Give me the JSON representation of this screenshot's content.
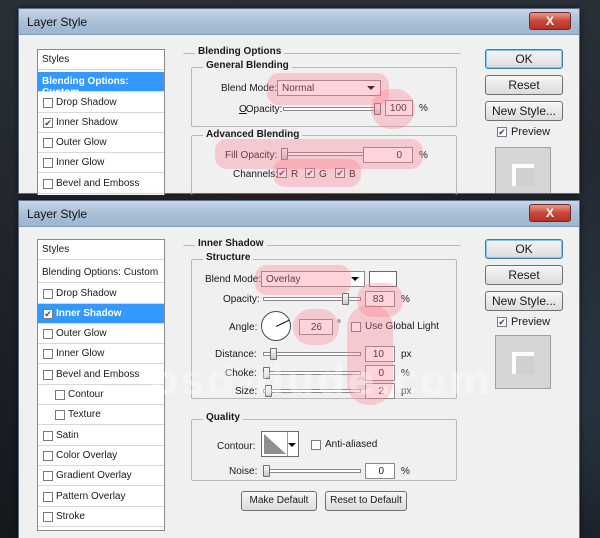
{
  "top_dialog": {
    "title": "Layer Style",
    "close": "X",
    "styles_list": {
      "header": "Styles",
      "selected": "Blending Options: Custom",
      "items": [
        {
          "label": "Drop Shadow",
          "checked": false
        },
        {
          "label": "Inner Shadow",
          "checked": true
        },
        {
          "label": "Outer Glow",
          "checked": false
        },
        {
          "label": "Inner Glow",
          "checked": false
        },
        {
          "label": "Bevel and Emboss",
          "checked": false
        }
      ]
    },
    "blending_options": {
      "title": "Blending Options",
      "general": {
        "title": "General Blending",
        "blend_mode_label": "Blend Mode:",
        "blend_mode_value": "Normal",
        "opacity_label": "Opacity:",
        "opacity_value": "100",
        "opacity_unit": "%"
      },
      "advanced": {
        "title": "Advanced Blending",
        "fill_opacity_label": "Fill Opacity:",
        "fill_opacity_value": "0",
        "fill_opacity_unit": "%",
        "channels_label": "Channels:",
        "channels": [
          "R",
          "G",
          "B"
        ]
      }
    },
    "buttons": {
      "ok": "OK",
      "reset": "Reset",
      "new_style": "New Style...",
      "preview": "Preview"
    }
  },
  "bottom_dialog": {
    "title": "Layer Style",
    "close": "X",
    "styles_list": {
      "header": "Styles",
      "blending": "Blending Options: Custom",
      "items": [
        {
          "label": "Drop Shadow",
          "checked": false,
          "sub": false
        },
        {
          "label": "Inner Shadow",
          "checked": true,
          "sub": false,
          "selected": true
        },
        {
          "label": "Outer Glow",
          "checked": false,
          "sub": false
        },
        {
          "label": "Inner Glow",
          "checked": false,
          "sub": false
        },
        {
          "label": "Bevel and Emboss",
          "checked": false,
          "sub": false
        },
        {
          "label": "Contour",
          "checked": false,
          "sub": true
        },
        {
          "label": "Texture",
          "checked": false,
          "sub": true
        },
        {
          "label": "Satin",
          "checked": false,
          "sub": false
        },
        {
          "label": "Color Overlay",
          "checked": false,
          "sub": false
        },
        {
          "label": "Gradient Overlay",
          "checked": false,
          "sub": false
        },
        {
          "label": "Pattern Overlay",
          "checked": false,
          "sub": false
        },
        {
          "label": "Stroke",
          "checked": false,
          "sub": false
        }
      ]
    },
    "inner_shadow": {
      "title": "Inner Shadow",
      "structure": {
        "title": "Structure",
        "blend_mode_label": "Blend Mode:",
        "blend_mode_value": "Overlay",
        "opacity_label": "Opacity:",
        "opacity_value": "83",
        "opacity_unit": "%",
        "angle_label": "Angle:",
        "angle_value": "26",
        "angle_unit": "°",
        "use_global_light": "Use Global Light",
        "distance_label": "Distance:",
        "distance_value": "10",
        "distance_unit": "px",
        "choke_label": "Choke:",
        "choke_value": "0",
        "choke_unit": "%",
        "size_label": "Size:",
        "size_value": "2",
        "size_unit": "px"
      },
      "quality": {
        "title": "Quality",
        "contour_label": "Contour:",
        "anti_aliased": "Anti-aliased",
        "noise_label": "Noise:",
        "noise_value": "0",
        "noise_unit": "%"
      },
      "make_default": "Make Default",
      "reset_to_default": "Reset to Default"
    },
    "buttons": {
      "ok": "OK",
      "reset": "Reset",
      "new_style": "New Style...",
      "preview": "Preview"
    }
  },
  "watermark": "psd-dude.com",
  "colors": {
    "selection": "#3399ff",
    "highlight": "#ff788c",
    "titlebar": "#a9c0d8"
  }
}
